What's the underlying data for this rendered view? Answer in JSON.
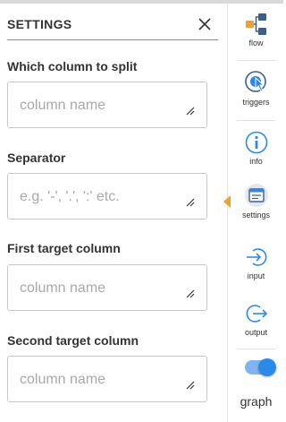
{
  "panel": {
    "title": "SETTINGS",
    "fields": [
      {
        "label": "Which column to split",
        "placeholder": "column name",
        "value": ""
      },
      {
        "label": "Separator",
        "placeholder": "e.g. '-', '.', ':' etc.",
        "value": ""
      },
      {
        "label": "First target column",
        "placeholder": "column name",
        "value": ""
      },
      {
        "label": "Second target column",
        "placeholder": "column name",
        "value": ""
      }
    ]
  },
  "sidebar": {
    "items": [
      {
        "label": "flow",
        "icon": "flow-icon"
      },
      {
        "label": "triggers",
        "icon": "triggers-icon"
      },
      {
        "label": "info",
        "icon": "info-icon"
      },
      {
        "label": "settings",
        "icon": "settings-icon",
        "selected": true
      },
      {
        "label": "input",
        "icon": "input-icon"
      },
      {
        "label": "output",
        "icon": "output-icon"
      }
    ],
    "toggle": {
      "label": "graph",
      "on": true
    }
  },
  "colors": {
    "accent": "#2b8ae8",
    "orange": "#f0a030",
    "text": "#333333"
  }
}
